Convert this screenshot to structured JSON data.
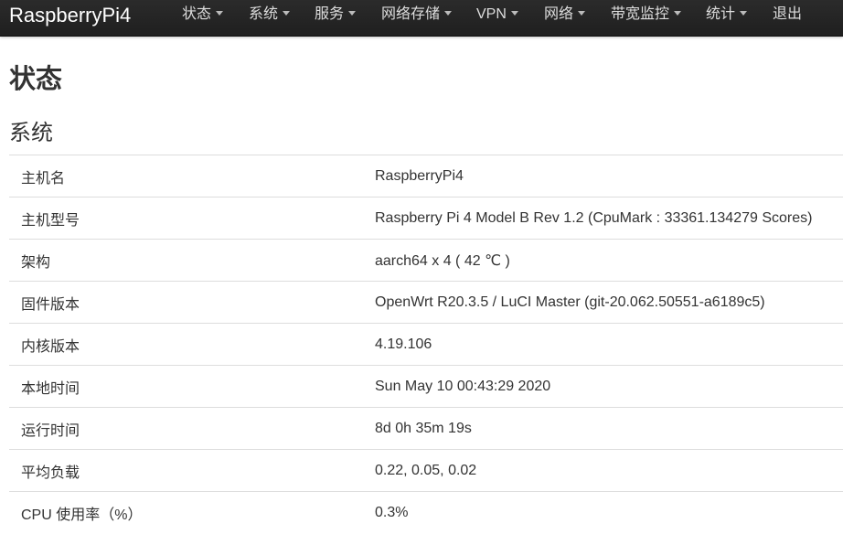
{
  "header": {
    "brand": "RaspberryPi4",
    "menu": [
      {
        "label": "状态",
        "has_dropdown": true
      },
      {
        "label": "系统",
        "has_dropdown": true
      },
      {
        "label": "服务",
        "has_dropdown": true
      },
      {
        "label": "网络存储",
        "has_dropdown": true
      },
      {
        "label": "VPN",
        "has_dropdown": true
      },
      {
        "label": "网络",
        "has_dropdown": true
      },
      {
        "label": "带宽监控",
        "has_dropdown": true
      },
      {
        "label": "统计",
        "has_dropdown": true
      },
      {
        "label": "退出",
        "has_dropdown": false
      }
    ]
  },
  "page": {
    "title": "状态",
    "section_title": "系统"
  },
  "system_info": [
    {
      "key": "主机名",
      "value": "RaspberryPi4"
    },
    {
      "key": "主机型号",
      "value": "Raspberry Pi 4 Model B Rev 1.2 (CpuMark : 33361.134279 Scores)"
    },
    {
      "key": "架构",
      "value": "aarch64 x 4 ( 42 ℃ )"
    },
    {
      "key": "固件版本",
      "value": "OpenWrt R20.3.5 / LuCI Master (git-20.062.50551-a6189c5)"
    },
    {
      "key": "内核版本",
      "value": "4.19.106"
    },
    {
      "key": "本地时间",
      "value": "Sun May 10 00:43:29 2020"
    },
    {
      "key": "运行时间",
      "value": "8d 0h 35m 19s"
    },
    {
      "key": "平均负载",
      "value": "0.22, 0.05, 0.02"
    },
    {
      "key": "CPU 使用率（%）",
      "value": "0.3%"
    }
  ],
  "colors": {
    "navbar_bg": "#222222",
    "nav_text": "#dddddd",
    "brand_text": "#ffffff",
    "body_text": "#333333",
    "row_border": "#dddddd"
  }
}
